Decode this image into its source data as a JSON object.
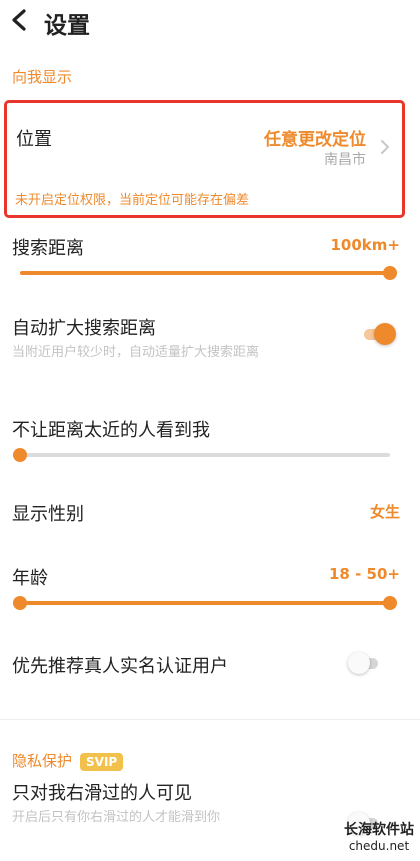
{
  "header": {
    "title": "设置",
    "back_icon": "chevron-left-icon"
  },
  "section_show": {
    "label": "向我显示"
  },
  "location": {
    "title": "位置",
    "action": "任意更改定位",
    "city": "南昌市",
    "warning": "未开启定位权限，当前定位可能存在偏差"
  },
  "search_distance": {
    "title": "搜索距离",
    "value": "100km+",
    "fill_fraction": 1.0
  },
  "auto_expand": {
    "title": "自动扩大搜索距离",
    "hint": "当附近用户较少时，自动适量扩大搜索距离",
    "enabled": true
  },
  "hide_nearby": {
    "title": "不让距离太近的人看到我",
    "fill_fraction": 0.0
  },
  "gender": {
    "title": "显示性别",
    "value": "女生"
  },
  "age": {
    "title": "年龄",
    "value": "18 - 50+",
    "range": [
      0.0,
      1.0
    ]
  },
  "verified_first": {
    "title": "优先推荐真人实名认证用户",
    "enabled": false
  },
  "privacy": {
    "label": "隐私保护",
    "badge": "SVIP"
  },
  "swiped_only": {
    "title": "只对我右滑过的人可见",
    "hint": "开启后只有你右滑过的人才能滑到你",
    "enabled": false
  },
  "watermark": {
    "main": "长海软件站",
    "sub": "chedu.net"
  },
  "colors": {
    "accent": "#ef8a2c",
    "alert_border": "#e8362c",
    "svip": "#f1c14b"
  }
}
